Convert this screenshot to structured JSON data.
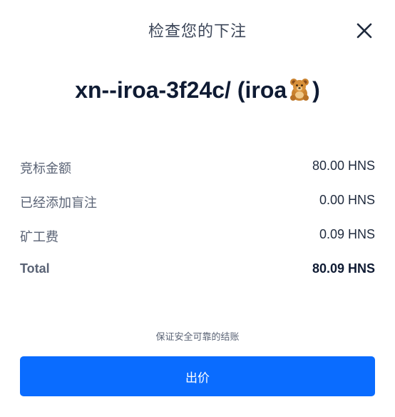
{
  "dialog": {
    "title": "检查您的下注",
    "close_icon": "close-icon"
  },
  "name": {
    "ascii": "xn--iroa-3f24c/",
    "display_prefix": "(iroa",
    "emoji_icon": "teddy-bear-icon",
    "display_suffix": ")"
  },
  "summary": {
    "rows": [
      {
        "label": "竞标金额",
        "value": "80.00 HNS"
      },
      {
        "label": "已经添加盲注",
        "value": "0.00 HNS"
      },
      {
        "label": "矿工费",
        "value": "0.09 HNS"
      }
    ],
    "total": {
      "label": "Total",
      "value": "80.09 HNS"
    }
  },
  "footer": {
    "secure_text": "保证安全可靠的结账",
    "bid_button_label": "出价"
  },
  "colors": {
    "primary": "#0a6cff",
    "text_dark": "#0f1b33",
    "text_muted": "#5a6375"
  }
}
